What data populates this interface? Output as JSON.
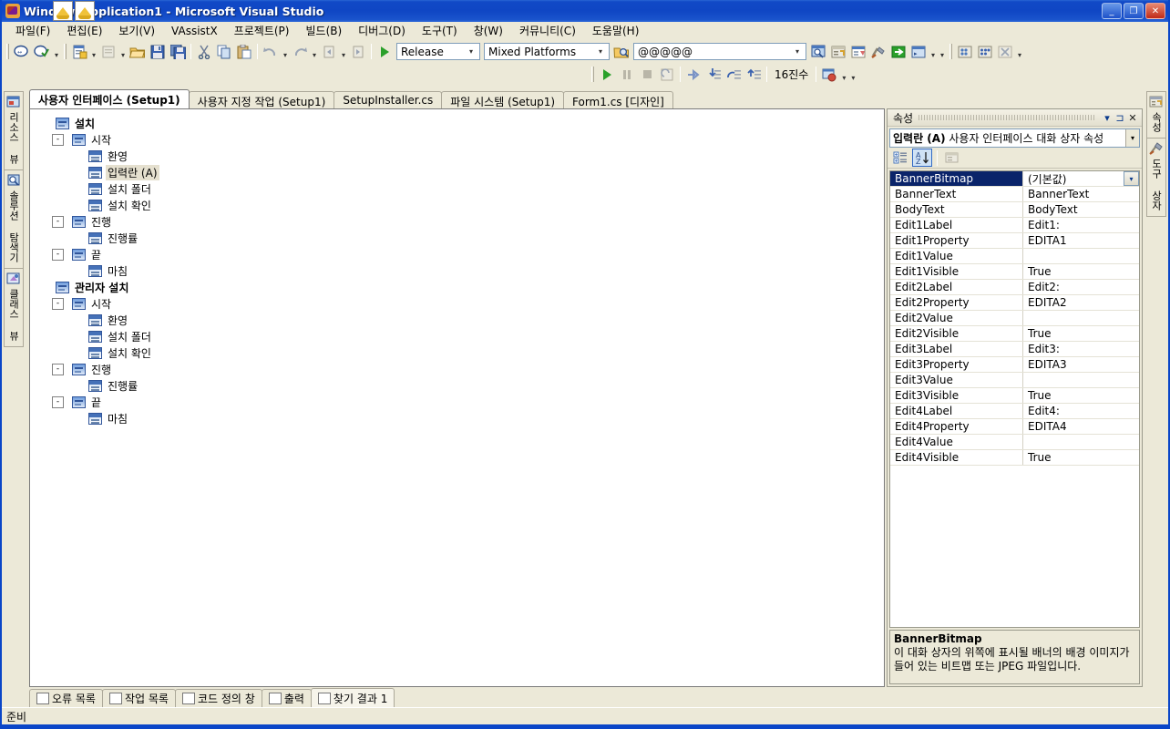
{
  "window": {
    "title": "WindowsApplication1 - Microsoft Visual Studio",
    "minimize": "_",
    "maximize": "❐",
    "close": "✕"
  },
  "menu": [
    {
      "label": "파일(F)",
      "key": "F"
    },
    {
      "label": "편집(E)",
      "key": "E"
    },
    {
      "label": "보기(V)",
      "key": "V"
    },
    {
      "label": "VAssistX",
      "key": "A"
    },
    {
      "label": "프로젝트(P)",
      "key": "P"
    },
    {
      "label": "빌드(B)",
      "key": "B"
    },
    {
      "label": "디버그(D)",
      "key": "D"
    },
    {
      "label": "도구(T)",
      "key": "T"
    },
    {
      "label": "창(W)",
      "key": "W"
    },
    {
      "label": "커뮤니티(C)",
      "key": "C"
    },
    {
      "label": "도움말(H)",
      "key": "H"
    }
  ],
  "toolbar": {
    "configuration": "Release",
    "platform": "Mixed Platforms",
    "find_box": "@@@@@",
    "hex_label": "16진수",
    "icons": [
      "new-item-icon",
      "add-item-icon",
      "open-icon",
      "save-icon",
      "save-all-icon",
      "cut-icon",
      "copy-icon",
      "paste-icon",
      "undo-icon",
      "redo-icon",
      "navigate-back-icon",
      "navigate-forward-icon",
      "start-debug-icon",
      "find-in-files-icon",
      "solution-explorer-icon",
      "properties-window-icon",
      "toolbox-icon",
      "go-to-icon",
      "other-windows-icon",
      "breakpoints-icon",
      "breakpoints-all-icon",
      "clear-bookmarks-icon"
    ],
    "debug_icons": [
      "continue-icon",
      "break-all-icon",
      "stop-debug-icon",
      "restart-icon",
      "show-next-statement-icon",
      "step-into-icon",
      "step-over-icon",
      "step-out-icon",
      "watch-icon"
    ]
  },
  "left_sidebar": [
    {
      "label": "리소스 뷰",
      "icon": "resource-view-icon"
    },
    {
      "label": "솔루션 탐색기",
      "icon": "solution-explorer-icon"
    },
    {
      "label": "클래스 뷰",
      "icon": "class-view-icon"
    }
  ],
  "right_sidebar": [
    {
      "label": "속성",
      "icon": "properties-icon"
    },
    {
      "label": "도구 상자",
      "icon": "toolbox-icon"
    }
  ],
  "doc_tabs": [
    {
      "label": "사용자 인터페이스 (Setup1)",
      "active": true
    },
    {
      "label": "사용자 지정 작업 (Setup1)",
      "active": false
    },
    {
      "label": "SetupInstaller.cs",
      "active": false
    },
    {
      "label": "파일 시스템 (Setup1)",
      "active": false
    },
    {
      "label": "Form1.cs [디자인]",
      "active": false
    }
  ],
  "tree": [
    {
      "label": "설치",
      "level": 0,
      "icon": "setup-root-icon",
      "bold": true,
      "expander": "",
      "selected": false
    },
    {
      "label": "시작",
      "level": 1,
      "icon": "dialog-group-icon",
      "bold": false,
      "expander": "-",
      "selected": false
    },
    {
      "label": "환영",
      "level": 2,
      "icon": "dialog-icon",
      "bold": false,
      "expander": "",
      "selected": false
    },
    {
      "label": "입력란  (A)",
      "level": 2,
      "icon": "dialog-icon",
      "bold": false,
      "expander": "",
      "selected": true
    },
    {
      "label": "설치 폴더",
      "level": 2,
      "icon": "dialog-icon",
      "bold": false,
      "expander": "",
      "selected": false
    },
    {
      "label": "설치 확인",
      "level": 2,
      "icon": "dialog-icon",
      "bold": false,
      "expander": "",
      "selected": false
    },
    {
      "label": "진행",
      "level": 1,
      "icon": "dialog-group-icon",
      "bold": false,
      "expander": "-",
      "selected": false
    },
    {
      "label": "진행률",
      "level": 2,
      "icon": "dialog-icon",
      "bold": false,
      "expander": "",
      "selected": false
    },
    {
      "label": "끝",
      "level": 1,
      "icon": "dialog-group-icon",
      "bold": false,
      "expander": "-",
      "selected": false
    },
    {
      "label": "마침",
      "level": 2,
      "icon": "dialog-icon",
      "bold": false,
      "expander": "",
      "selected": false
    },
    {
      "label": "관리자 설치",
      "level": 0,
      "icon": "setup-root-icon",
      "bold": true,
      "expander": "",
      "selected": false
    },
    {
      "label": "시작",
      "level": 1,
      "icon": "dialog-group-icon",
      "bold": false,
      "expander": "-",
      "selected": false
    },
    {
      "label": "환영",
      "level": 2,
      "icon": "dialog-icon",
      "bold": false,
      "expander": "",
      "selected": false
    },
    {
      "label": "설치 폴더",
      "level": 2,
      "icon": "dialog-icon",
      "bold": false,
      "expander": "",
      "selected": false
    },
    {
      "label": "설치 확인",
      "level": 2,
      "icon": "dialog-icon",
      "bold": false,
      "expander": "",
      "selected": false
    },
    {
      "label": "진행",
      "level": 1,
      "icon": "dialog-group-icon",
      "bold": false,
      "expander": "-",
      "selected": false
    },
    {
      "label": "진행률",
      "level": 2,
      "icon": "dialog-icon",
      "bold": false,
      "expander": "",
      "selected": false
    },
    {
      "label": "끝",
      "level": 1,
      "icon": "dialog-group-icon",
      "bold": false,
      "expander": "-",
      "selected": false
    },
    {
      "label": "마침",
      "level": 2,
      "icon": "dialog-icon",
      "bold": false,
      "expander": "",
      "selected": false
    }
  ],
  "properties": {
    "panel_title": "속성",
    "object_name_bold": "입력란  (A)",
    "object_name_rest": " 사용자 인터페이스 대화 상자 속성",
    "toolbar": {
      "categorized": "categorized-sort-icon",
      "alphabetical": "alphabetical-sort-icon",
      "property_pages": "property-pages-icon"
    },
    "rows": [
      {
        "name": "BannerBitmap",
        "value": "(기본값)",
        "selected": true
      },
      {
        "name": "BannerText",
        "value": "BannerText",
        "selected": false
      },
      {
        "name": "BodyText",
        "value": "BodyText",
        "selected": false
      },
      {
        "name": "Edit1Label",
        "value": "Edit1:",
        "selected": false
      },
      {
        "name": "Edit1Property",
        "value": "EDITA1",
        "selected": false
      },
      {
        "name": "Edit1Value",
        "value": "",
        "selected": false
      },
      {
        "name": "Edit1Visible",
        "value": "True",
        "selected": false
      },
      {
        "name": "Edit2Label",
        "value": "Edit2:",
        "selected": false
      },
      {
        "name": "Edit2Property",
        "value": "EDITA2",
        "selected": false
      },
      {
        "name": "Edit2Value",
        "value": "",
        "selected": false
      },
      {
        "name": "Edit2Visible",
        "value": "True",
        "selected": false
      },
      {
        "name": "Edit3Label",
        "value": "Edit3:",
        "selected": false
      },
      {
        "name": "Edit3Property",
        "value": "EDITA3",
        "selected": false
      },
      {
        "name": "Edit3Value",
        "value": "",
        "selected": false
      },
      {
        "name": "Edit3Visible",
        "value": "True",
        "selected": false
      },
      {
        "name": "Edit4Label",
        "value": "Edit4:",
        "selected": false
      },
      {
        "name": "Edit4Property",
        "value": "EDITA4",
        "selected": false
      },
      {
        "name": "Edit4Value",
        "value": "",
        "selected": false
      },
      {
        "name": "Edit4Visible",
        "value": "True",
        "selected": false
      }
    ],
    "description": {
      "title": "BannerBitmap",
      "text": "이 대화 상자의 위쪽에 표시될 배너의 배경 이미지가 들어 있는 비트맵 또는 JPEG 파일입니다."
    }
  },
  "bottom_tabs": [
    {
      "label": "오류 목록",
      "icon": "error-list-icon",
      "active": false
    },
    {
      "label": "작업 목록",
      "icon": "task-list-icon",
      "active": false
    },
    {
      "label": "코드 정의 창",
      "icon": "code-definition-icon",
      "active": false
    },
    {
      "label": "출력",
      "icon": "output-icon",
      "active": false
    },
    {
      "label": "찾기 결과 1",
      "icon": "find-results-icon",
      "active": true
    }
  ],
  "status": {
    "text": "준비"
  },
  "colors": {
    "titlebar_blue": "#0f46c4",
    "chrome": "#ece9d8",
    "selection_blue": "#0a246a",
    "inactive_selection": "#e5e0cf",
    "border": "#aca899"
  }
}
